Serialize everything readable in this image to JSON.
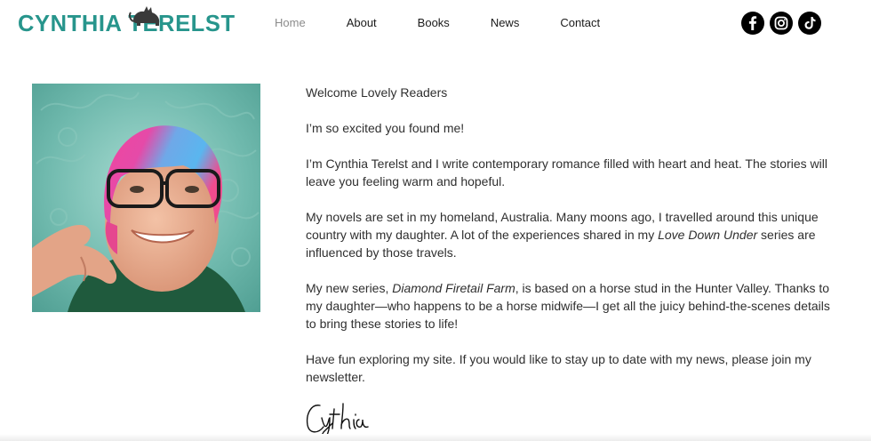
{
  "header": {
    "logo_text": "CYNTHIA TERELST",
    "nav": [
      {
        "label": "Home",
        "active": true
      },
      {
        "label": "About",
        "active": false
      },
      {
        "label": "Books",
        "active": false
      },
      {
        "label": "News",
        "active": false
      },
      {
        "label": "Contact",
        "active": false
      }
    ],
    "social": [
      "facebook-icon",
      "instagram-icon",
      "tiktok-icon"
    ]
  },
  "colors": {
    "brand_teal": "#27958c",
    "nav_active": "#8b8b8b",
    "text": "#2f2f2f"
  },
  "main": {
    "greeting": "Welcome Lovely Readers",
    "intro": "I’m so excited you found me!",
    "para1": "I’m Cynthia Terelst and I write contemporary romance filled with heart and heat. The stories will leave you feeling warm and hopeful.",
    "para2_before": "My novels are set in my homeland, Australia. Many moons ago, I travelled around this unique country with my daughter. A lot of the experiences shared in my ",
    "para2_italic": "Love Down Under",
    "para2_after": " series are influenced by those travels.",
    "para3_before": "My new series, ",
    "para3_italic": "Diamond Firetail Farm",
    "para3_after": ", is based on a horse stud in the Hunter Valley. Thanks to my daughter—who happens to be a horse midwife—I get all the juicy behind-the-scenes details to bring these stories to life!",
    "para4": "Have fun exploring my site. If you would like to stay up to date with my news, please join my newsletter.",
    "signature": "Cynthia"
  }
}
